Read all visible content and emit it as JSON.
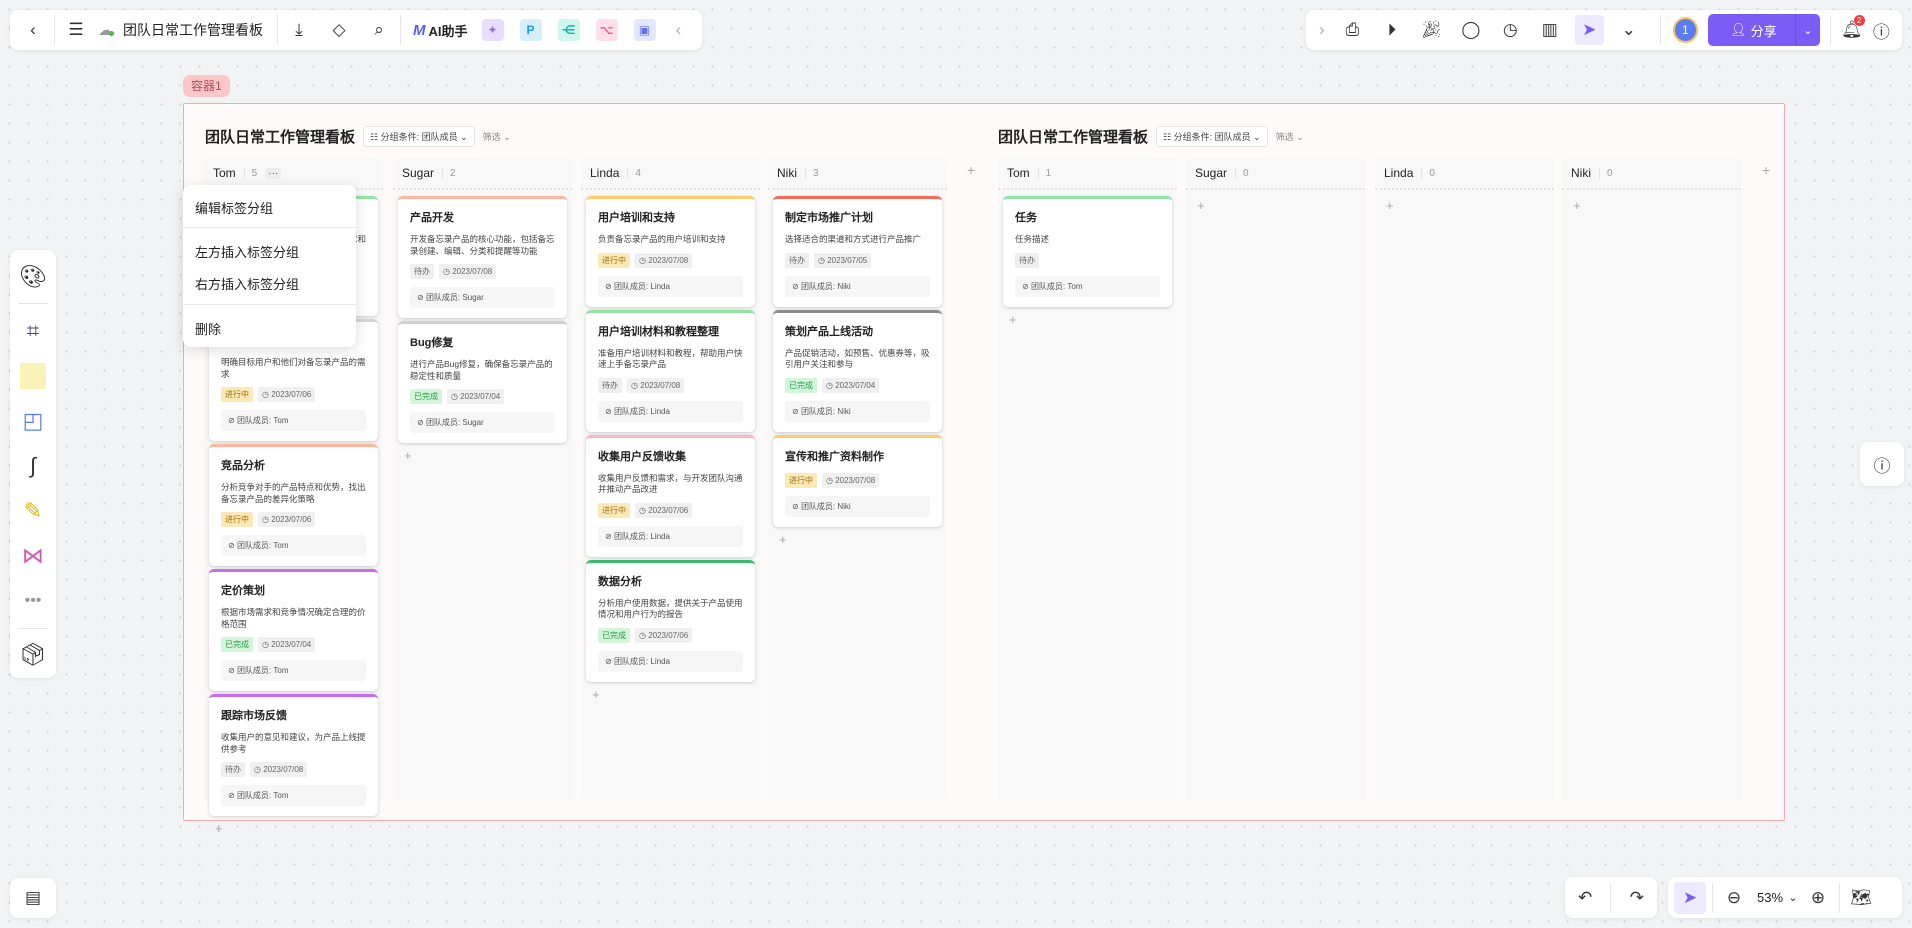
{
  "topbar": {
    "doc_title": "团队日常工作管理看板",
    "ai_label": "AI助手",
    "app_icons": [
      "image-gen-icon",
      "p-icon",
      "mindmap-icon",
      "flow-icon",
      "chat-icon"
    ]
  },
  "rightbar": {
    "avatar_number": "1",
    "share_label": "分享",
    "notification_count": "2"
  },
  "container_label": "容器1",
  "colors": {
    "accent": "#7b5cf5",
    "frame_border": "#f4a9ae",
    "notification": "#f03e3e"
  },
  "tag_styles": {
    "进行中": {
      "bg": "#fde9b8",
      "fg": "#a07000"
    },
    "待办": {
      "bg": "#efefef",
      "fg": "#666666"
    },
    "已完成": {
      "bg": "#d3f5da",
      "fg": "#2a9d4b"
    }
  },
  "boards": [
    {
      "title": "团队日常工作管理看板",
      "group_label": "分组条件: 团队成员",
      "filter_label": "筛选",
      "columns": [
        {
          "name": "Tom",
          "count": "5",
          "cards": [
            {
              "title": "",
              "desc": "求和",
              "status": "",
              "date": "",
              "member": "",
              "color": "#93e3a6",
              "hidden": true
            },
            {
              "title": "",
              "desc": "明确目标用户和他们对备忘录产品的需求",
              "status": "进行中",
              "date": "2023/07/06",
              "member": "团队成员: Tom",
              "color": "#d6d6d6"
            },
            {
              "title": "竞品分析",
              "desc": "分析竞争对手的产品特点和优势，找出备忘录产品的差异化策略",
              "status": "进行中",
              "date": "2023/07/06",
              "member": "团队成员: Tom",
              "color": "#ffb79d"
            },
            {
              "title": "定价策划",
              "desc": "根据市场需求和竞争情况确定合理的价格范围",
              "status": "已完成",
              "date": "2023/07/04",
              "member": "团队成员: Tom",
              "color": "#c56cf0"
            },
            {
              "title": "跟踪市场反馈",
              "desc": "收集用户的意见和建议，为产品上线提供参考",
              "status": "待办",
              "date": "2023/07/08",
              "member": "团队成员: Tom",
              "color": "#c56cf0"
            }
          ]
        },
        {
          "name": "Sugar",
          "count": "2",
          "cards": [
            {
              "title": "产品开发",
              "desc": "开发备忘录产品的核心功能，包括备忘录创建、编辑、分类和提醒等功能",
              "status": "待办",
              "date": "2023/07/08",
              "member": "团队成员: Sugar",
              "color": "#ffb79d"
            },
            {
              "title": "Bug修复",
              "desc": "进行产品Bug修复，确保备忘录产品的稳定性和质量",
              "status": "已完成",
              "date": "2023/07/04",
              "member": "团队成员: Sugar",
              "color": "#cfcfcf"
            }
          ]
        },
        {
          "name": "Linda",
          "count": "4",
          "cards": [
            {
              "title": "用户培训和支持",
              "desc": "负责备忘录产品的用户培训和支持",
              "status": "进行中",
              "date": "2023/07/08",
              "member": "团队成员: Linda",
              "color": "#ffcb6b"
            },
            {
              "title": "用户培训材料和教程整理",
              "desc": "准备用户培训材料和教程，帮助用户快速上手备忘录产品",
              "status": "待办",
              "date": "2023/07/08",
              "member": "团队成员: Linda",
              "color": "#93e3a6"
            },
            {
              "title": "收集用户反馈收集",
              "desc": "收集用户反馈和需求，与开发团队沟通并推动产品改进",
              "status": "进行中",
              "date": "2023/07/06",
              "member": "团队成员: Linda",
              "color": "#ffb3c1"
            },
            {
              "title": "数据分析",
              "desc": "分析用户使用数据，提供关于产品使用情况和用户行为的报告",
              "status": "已完成",
              "date": "2023/07/06",
              "member": "团队成员: Linda",
              "color": "#3cba6f"
            }
          ]
        },
        {
          "name": "Niki",
          "count": "3",
          "cards": [
            {
              "title": "制定市场推广计划",
              "desc": "选择适合的渠道和方式进行产品推广",
              "status": "待办",
              "date": "2023/07/05",
              "member": "团队成员: Niki",
              "color": "#f56c5b"
            },
            {
              "title": "策划产品上线活动",
              "desc": "产品促销活动，如预售、优惠券等，吸引用户关注和参与",
              "status": "已完成",
              "date": "2023/07/04",
              "member": "团队成员: Niki",
              "color": "#8c8c8c"
            },
            {
              "title": "宣传和推广资料制作",
              "desc": "",
              "status": "进行中",
              "date": "2023/07/08",
              "member": "团队成员: Niki",
              "color": "#ffcb6b"
            }
          ]
        }
      ]
    },
    {
      "title": "团队日常工作管理看板",
      "group_label": "分组条件: 团队成员",
      "filter_label": "筛选",
      "columns": [
        {
          "name": "Tom",
          "count": "1",
          "cards": [
            {
              "title": "任务",
              "desc": "任务描述",
              "status": "待办",
              "date": "",
              "member": "团队成员: Tom",
              "color": "#93e3a6"
            }
          ]
        },
        {
          "name": "Sugar",
          "count": "0",
          "cards": []
        },
        {
          "name": "Linda",
          "count": "0",
          "cards": []
        },
        {
          "name": "Niki",
          "count": "0",
          "cards": []
        }
      ]
    }
  ],
  "context_menu": {
    "items": [
      "编辑标签分组",
      "左方插入标签分组",
      "右方插入标签分组",
      "删除"
    ]
  },
  "zoom": {
    "level": "53%"
  }
}
